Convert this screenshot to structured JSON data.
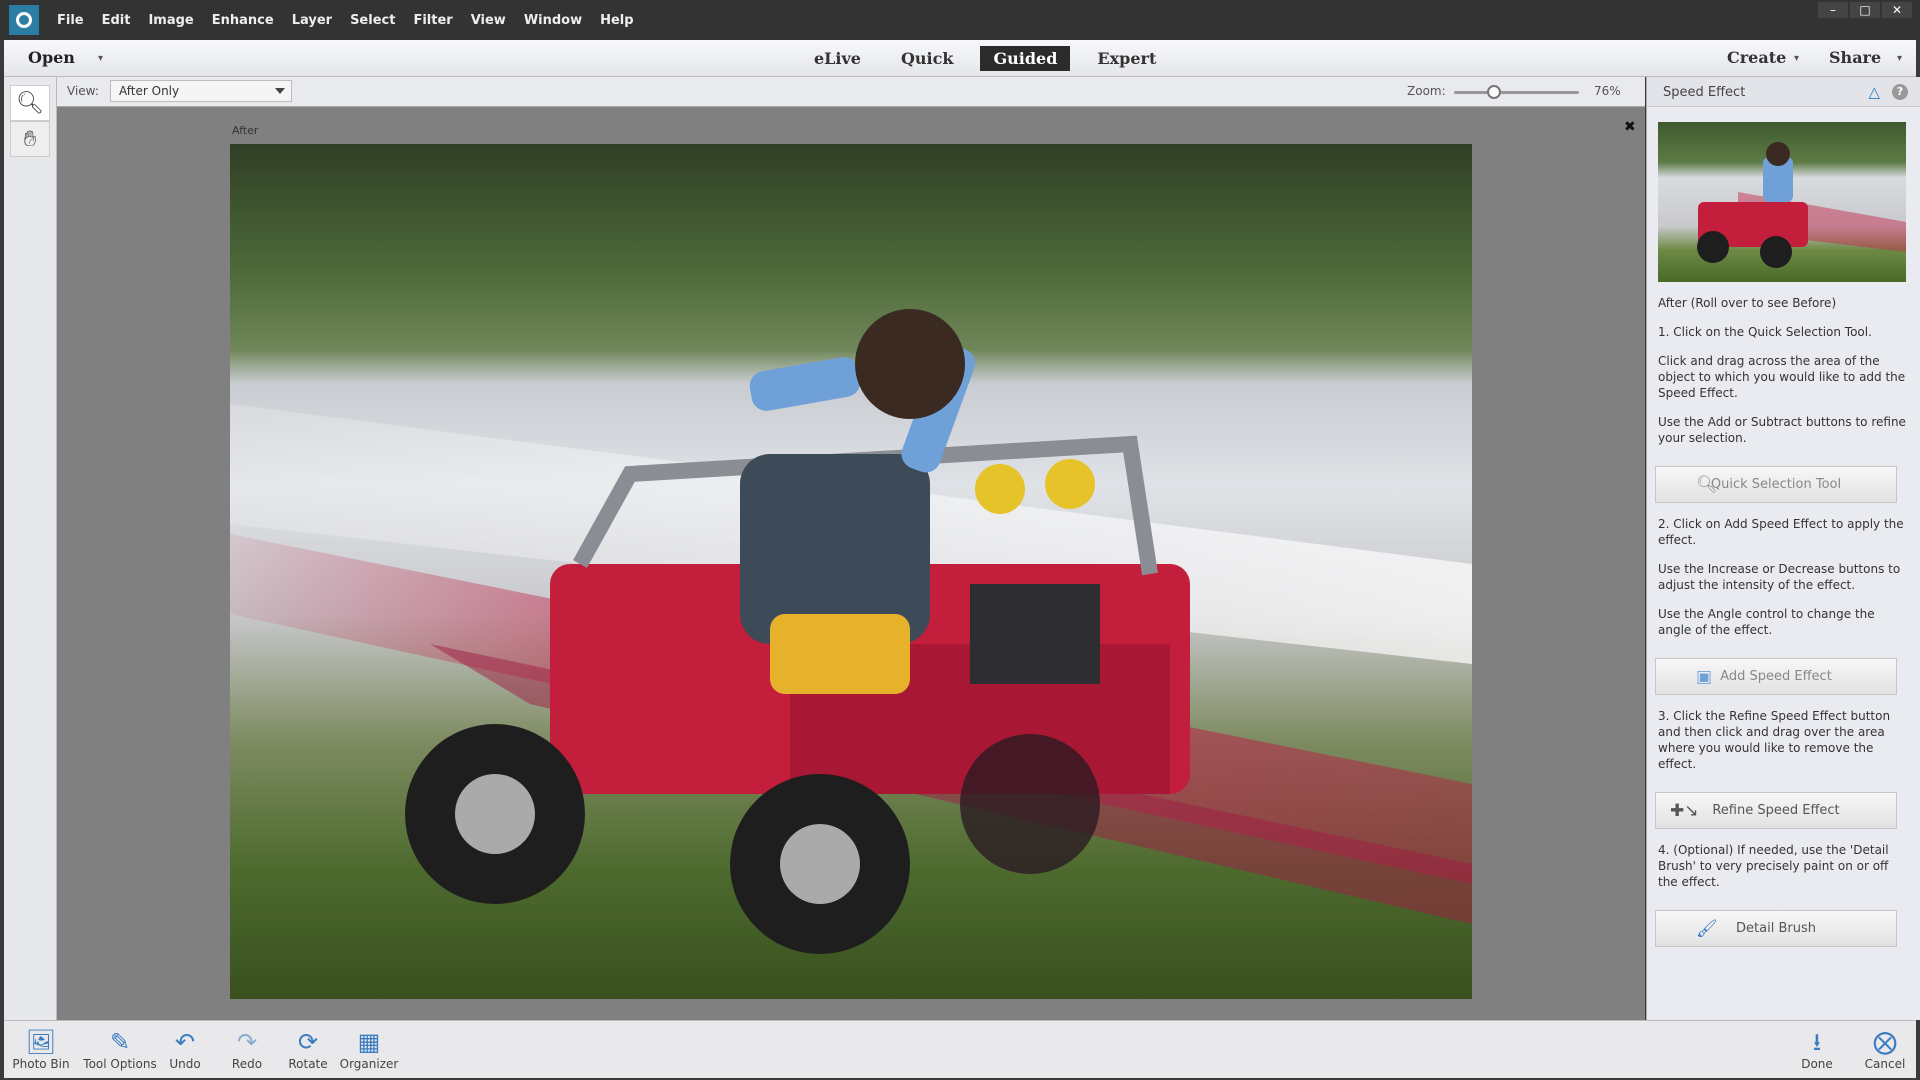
{
  "menubar": {
    "items": [
      "File",
      "Edit",
      "Image",
      "Enhance",
      "Layer",
      "Select",
      "Filter",
      "View",
      "Window",
      "Help"
    ],
    "window_controls": [
      "minimize",
      "maximize",
      "close"
    ]
  },
  "modebar": {
    "open_label": "Open",
    "modes": [
      "eLive",
      "Quick",
      "Guided",
      "Expert"
    ],
    "active_mode": "Guided",
    "create_label": "Create",
    "share_label": "Share"
  },
  "tools": [
    "zoom-tool",
    "hand-tool"
  ],
  "viewbar": {
    "view_label": "View:",
    "view_value": "After Only",
    "zoom_label": "Zoom:",
    "zoom_value": "76%",
    "zoom_percent": 76
  },
  "canvas": {
    "after_label": "After"
  },
  "panel": {
    "title": "Speed Effect",
    "caption": "After (Roll over to see Before)",
    "step1": "1. Click on the Quick Selection Tool.",
    "step1a": "Click and drag across the area of the object to which you would like to add the Speed Effect.",
    "step1b": "Use the Add or Subtract buttons to refine your selection.",
    "btn_quick": "Quick Selection Tool",
    "step2": "2. Click on Add Speed Effect to apply the effect.",
    "step2a": "Use the Increase or Decrease buttons to adjust the intensity of the effect.",
    "step2b": "Use the Angle control to change the angle of the effect.",
    "btn_add": "Add Speed Effect",
    "step3": "3. Click the Refine Speed Effect button and then click and drag over the area where you would like to remove the effect.",
    "btn_refine": "Refine Speed Effect",
    "step4": "4. (Optional) If needed, use the 'Detail Brush' to very precisely paint on or off the effect.",
    "btn_detail": "Detail Brush"
  },
  "bottombar": {
    "photo_bin": "Photo Bin",
    "tool_options": "Tool Options",
    "undo": "Undo",
    "redo": "Redo",
    "rotate": "Rotate",
    "organizer": "Organizer",
    "done": "Done",
    "cancel": "Cancel"
  },
  "colors": {
    "accent": "#3b7cc0",
    "active_mode_bg": "#2b2b2b",
    "canvas_bg": "#808080"
  }
}
